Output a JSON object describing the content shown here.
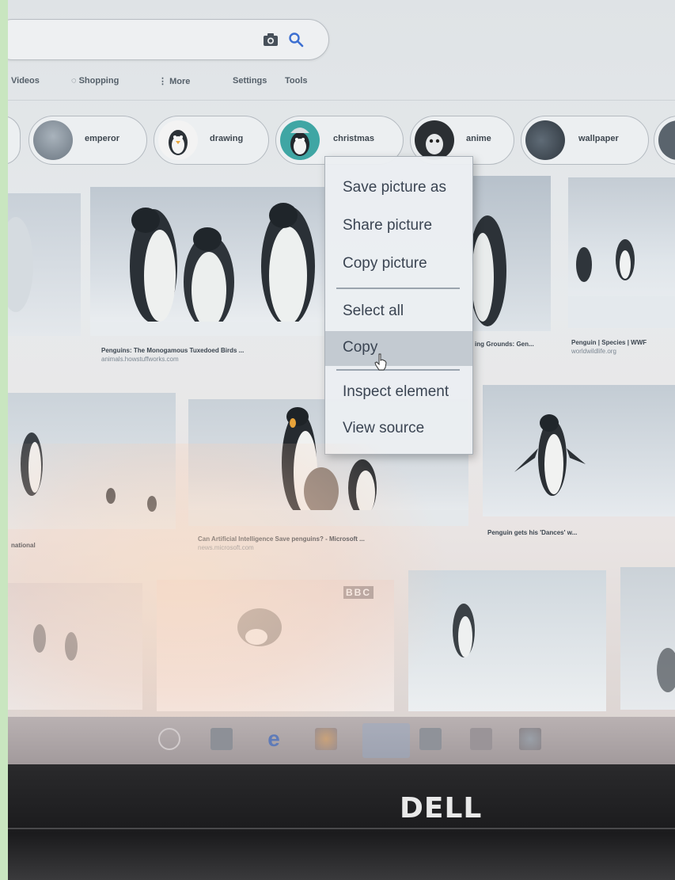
{
  "search": {
    "camera_icon": "camera-icon",
    "search_icon": "search-icon"
  },
  "nav": {
    "tabs": [
      "Videos",
      "Shopping",
      "More",
      "Settings",
      "Tools"
    ]
  },
  "chips": [
    "emperor",
    "drawing",
    "christmas",
    "anime",
    "wallpaper"
  ],
  "results": [
    {
      "title": "Penguins: The Monogamous Tuxedoed Birds ...",
      "source": "animals.howstuffworks.com"
    },
    {
      "title": "ing Grounds: Gen...",
      "source": ""
    },
    {
      "title": "Penguin | Species | WWF",
      "source": "worldwildlife.org"
    },
    {
      "title": "national",
      "source": ""
    },
    {
      "title": "Can Artificial Intelligence Save penguins? - Microsoft ...",
      "source": "news.microsoft.com"
    },
    {
      "title": "Penguin gets his 'Dances' w...",
      "source": ""
    }
  ],
  "context_menu": {
    "items": [
      "Save picture as",
      "Share picture",
      "Copy picture",
      "Select all",
      "Copy",
      "Inspect element",
      "View source"
    ],
    "highlighted": "Copy"
  },
  "overlay_badge": "BBC",
  "brand": "DELL",
  "colors": {
    "screen": "#e5e8ea",
    "menu_bg": "#ebeef1",
    "menu_highlight": "#c3cad1",
    "bezel": "#1b1b1d"
  }
}
